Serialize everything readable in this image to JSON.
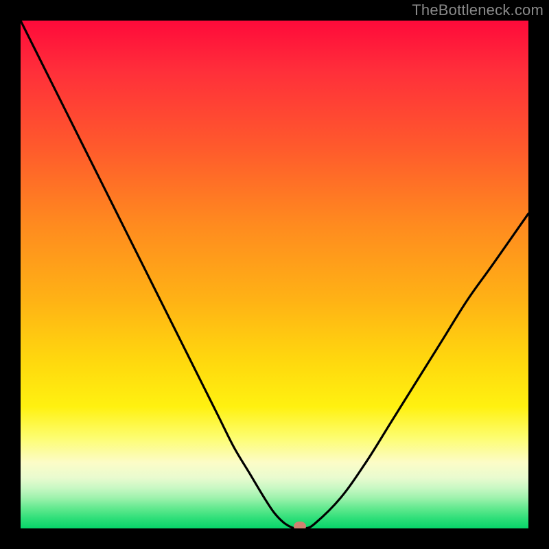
{
  "watermark": "TheBottleneck.com",
  "colors": {
    "frame": "#000000",
    "curve_stroke": "#000000",
    "marker": "#cf8271",
    "watermark_text": "#8a8a8a"
  },
  "chart_data": {
    "type": "line",
    "title": "",
    "xlabel": "",
    "ylabel": "",
    "xlim": [
      0,
      100
    ],
    "ylim": [
      0,
      100
    ],
    "series": [
      {
        "name": "bottleneck-curve",
        "x": [
          0,
          3,
          6,
          9,
          12,
          15,
          18,
          21,
          24,
          27,
          30,
          33,
          36,
          39,
          42,
          45,
          48,
          50,
          52,
          54,
          56,
          58,
          63,
          68,
          73,
          78,
          83,
          88,
          93,
          100
        ],
        "values": [
          100,
          94,
          88,
          82,
          76,
          70,
          64,
          58,
          52,
          46,
          40,
          34,
          28,
          22,
          16,
          11,
          6,
          3,
          1,
          0,
          0,
          1,
          6,
          13,
          21,
          29,
          37,
          45,
          52,
          62
        ]
      }
    ],
    "annotations": [
      {
        "name": "optimal-marker",
        "x": 55,
        "y": 0
      }
    ],
    "background_gradient_semantic": "red-top (bad) to green-bottom (good)"
  }
}
